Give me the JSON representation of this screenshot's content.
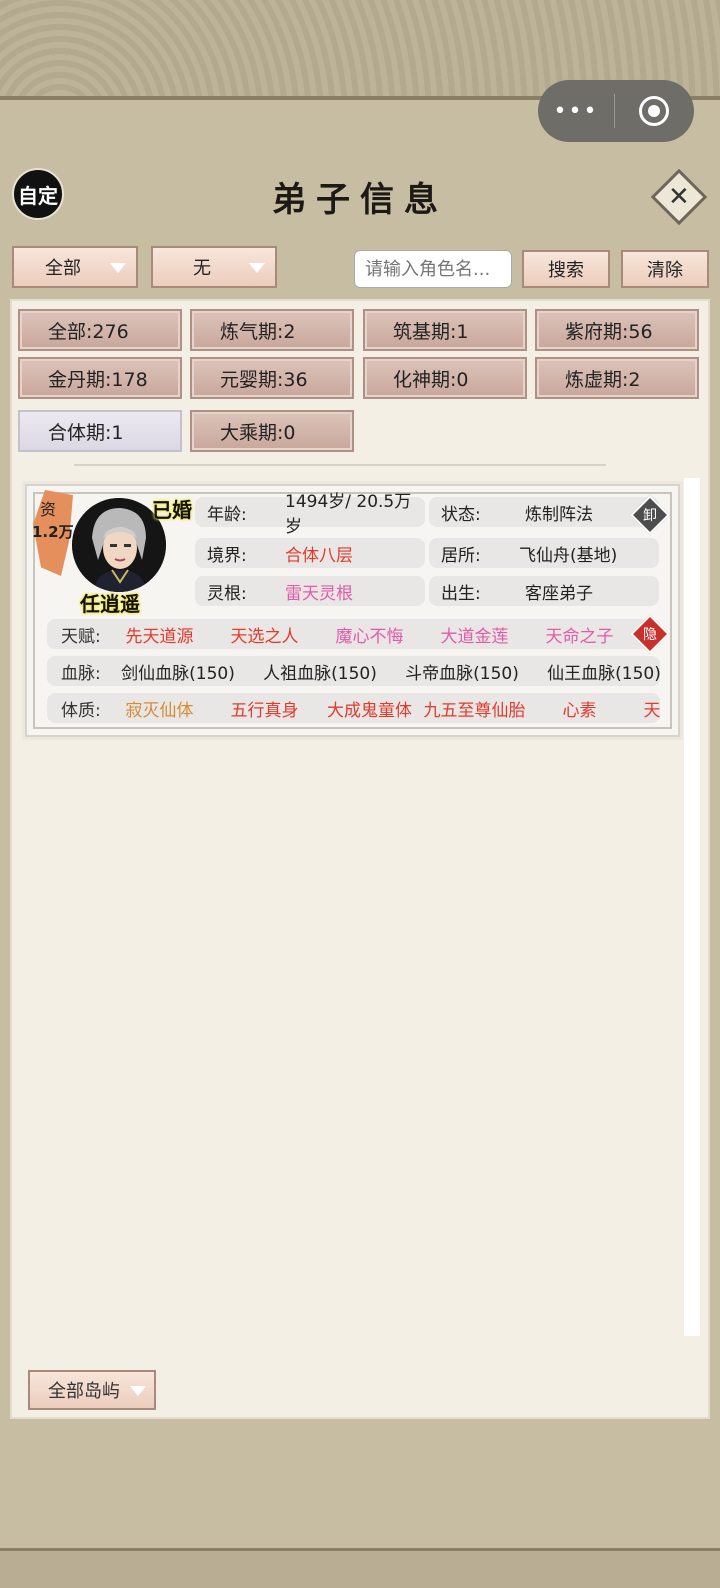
{
  "header": {
    "badge": "自定",
    "title": "弟子信息"
  },
  "filters": {
    "realm_select": "全部",
    "second_select": "无",
    "search_placeholder": "请输入角色名...",
    "search_label": "搜索",
    "clear_label": "清除"
  },
  "stats": [
    "全部:276",
    "炼气期:2",
    "筑基期:1",
    "紫府期:56",
    "金丹期:178",
    "元婴期:36",
    "化神期:0",
    "炼虚期:2",
    "合体期:1",
    "大乘期:0"
  ],
  "disciple": {
    "aptitude_label": "资",
    "aptitude_value": "1.2万",
    "married": "已婚",
    "name": "任逍遥",
    "age_label": "年龄:",
    "age_value": "1494岁/ 20.5万岁",
    "state_label": "状态:",
    "state_value": "炼制阵法",
    "realm_label": "境界:",
    "realm_value": "合体八层",
    "residence_label": "居所:",
    "residence_value": "飞仙舟(基地)",
    "root_label": "灵根:",
    "root_value": "雷天灵根",
    "origin_label": "出生:",
    "origin_value": "客座弟子",
    "unload_tag": "卸",
    "hide_tag": "隐",
    "talent_label": "天赋:",
    "talents": [
      "先天道源",
      "天选之人",
      "魔心不悔",
      "大道金莲",
      "天命之子"
    ],
    "bloodline_label": "血脉:",
    "bloodlines": [
      "剑仙血脉(150)",
      "人祖血脉(150)",
      "斗帝血脉(150)",
      "仙王血脉(150)"
    ],
    "physique_label": "体质:",
    "physiques": [
      "寂灭仙体",
      "五行真身",
      "大成鬼童体",
      "九五至尊仙胎",
      "心素",
      "天"
    ]
  },
  "footer": {
    "island_select": "全部岛屿"
  },
  "colors": {
    "red_text": "#e43a2d",
    "pink_text": "#e55aa8",
    "orange_text": "#d78b36",
    "button_bg": "#eccdbd",
    "stat_bg": "#c9a79b"
  }
}
